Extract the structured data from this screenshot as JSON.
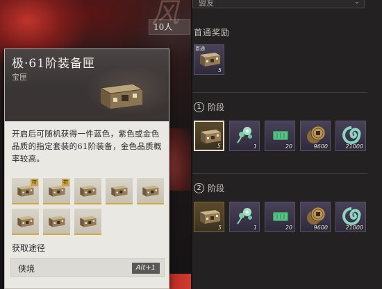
{
  "background": {
    "title_glyph": "风",
    "people_badge": "10人"
  },
  "item_card": {
    "title": "极·61阶装备匣",
    "subtitle": "宝匣",
    "description": "开启后可随机获得一件蓝色，紫色或金色品质的指定套装的61阶装备，金色品质概率较高。",
    "possible_items": [
      {
        "badge": "符"
      },
      {
        "badge": "符"
      },
      {
        "badge": ""
      },
      {
        "badge": ""
      },
      {
        "badge": ""
      },
      {
        "badge": ""
      },
      {
        "badge": ""
      },
      {
        "badge": ""
      }
    ],
    "source_label": "获取途径",
    "source": {
      "name": "侠境",
      "shortcut": "Alt+1"
    }
  },
  "right_panel": {
    "dropdown_value": "盟友",
    "first_reward": {
      "title": "首通奖励",
      "items": [
        {
          "tag": "首通",
          "icon": "chest-icon",
          "count": "5"
        }
      ]
    },
    "stages": [
      {
        "number": "1",
        "label": "阶段",
        "items": [
          {
            "icon": "chest-icon",
            "count": "5",
            "selected": true,
            "style": "gold"
          },
          {
            "icon": "jade-flower-icon",
            "count": "1",
            "style": "purple"
          },
          {
            "icon": "jade-slip-icon",
            "count": "20",
            "style": "purple"
          },
          {
            "icon": "coin-icon",
            "count": "9600",
            "style": "purple"
          },
          {
            "icon": "swirl-icon",
            "count": "21000",
            "style": "purple"
          }
        ]
      },
      {
        "number": "2",
        "label": "阶段",
        "items": [
          {
            "icon": "chest-icon",
            "count": "5",
            "selected": false,
            "style": "gold"
          },
          {
            "icon": "jade-flower-icon",
            "count": "1",
            "style": "purple"
          },
          {
            "icon": "jade-slip-icon",
            "count": "20",
            "style": "purple"
          },
          {
            "icon": "coin-icon",
            "count": "9600",
            "style": "purple"
          },
          {
            "icon": "swirl-icon",
            "count": "21000",
            "style": "purple"
          }
        ]
      }
    ]
  }
}
